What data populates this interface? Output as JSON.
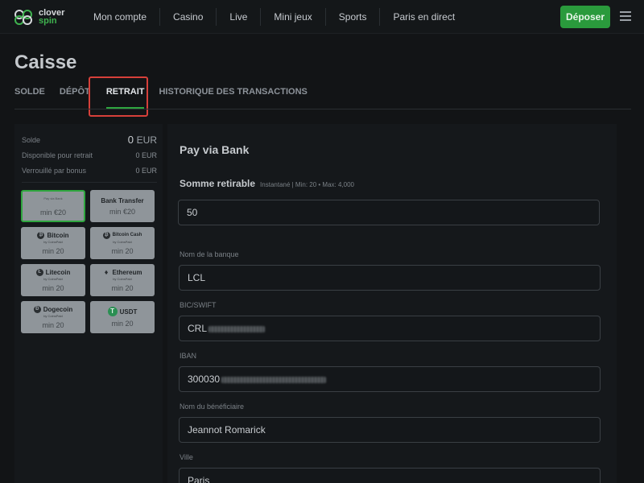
{
  "header": {
    "logo_line1": "clover",
    "logo_line2": "spin",
    "nav": [
      "Mon compte",
      "Casino",
      "Live",
      "Mini jeux",
      "Sports",
      "Paris en direct"
    ],
    "deposit_label": "Déposer"
  },
  "page": {
    "title": "Caisse",
    "tabs": [
      "SOLDE",
      "DÉPÔT",
      "RETRAIT",
      "HISTORIQUE DES TRANSACTIONS"
    ],
    "active_tab": "RETRAIT"
  },
  "balance": {
    "solde_label": "Solde",
    "solde_value": "0",
    "solde_currency": "EUR",
    "disponible_label": "Disponible pour retrait",
    "disponible_value": "0 EUR",
    "verrouille_label": "Verrouillé par bonus",
    "verrouille_value": "0 EUR"
  },
  "methods": [
    {
      "name": "Pay via Bank",
      "min": "min €20",
      "selected": true
    },
    {
      "name": "Bank Transfer",
      "min": "min €20"
    },
    {
      "name": "Bitcoin",
      "sub": "by CoinsPaid",
      "min": "min 20"
    },
    {
      "name": "Bitcoin Cash",
      "sub": "by CoinsPaid",
      "min": "min 20"
    },
    {
      "name": "Litecoin",
      "sub": "by CoinsPaid",
      "min": "min 20"
    },
    {
      "name": "Ethereum",
      "sub": "by CoinsPaid",
      "min": "min 20"
    },
    {
      "name": "Dogecoin",
      "sub": "by CoinsPaid",
      "min": "min 20"
    },
    {
      "name": "USDT",
      "min": "min 20"
    }
  ],
  "form": {
    "title": "Pay via Bank",
    "amount_label": "Somme retirable",
    "amount_hint": "Instantané | Min: 20 • Max: 4,000",
    "amount_value": "50",
    "bank_label": "Nom de la banque",
    "bank_value": "LCL",
    "bic_label": "BIC/SWIFT",
    "bic_value": "CRL",
    "iban_label": "IBAN",
    "iban_value": "300030",
    "beneficiary_label": "Nom du bénéficiaire",
    "beneficiary_value": "Jeannot Romarick",
    "city_label": "Ville",
    "city_value": "Paris"
  },
  "colors": {
    "accent_green": "#2a9a3c",
    "highlight_red": "#d6403a"
  }
}
